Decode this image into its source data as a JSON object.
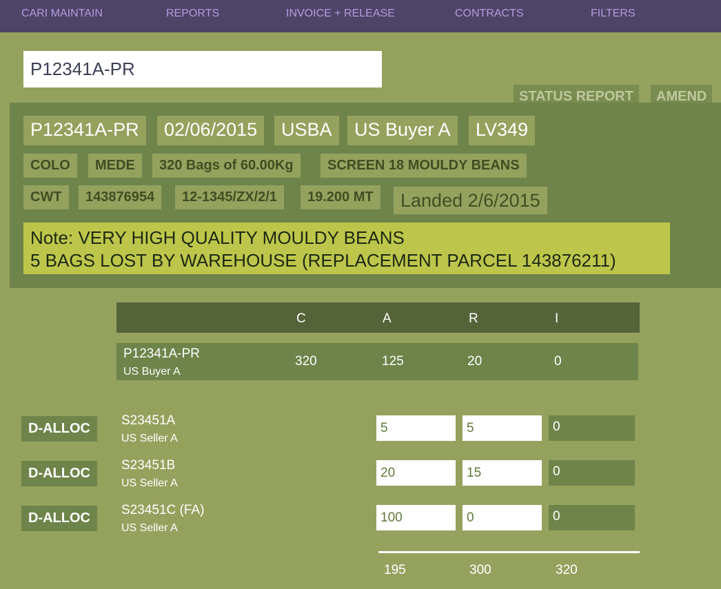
{
  "nav": {
    "items": [
      "CARI MAINTAIN",
      "REPORTS",
      "INVOICE + RELEASE",
      "CONTRACTS",
      "FILTERS"
    ]
  },
  "search": {
    "value": "P12341A-PR"
  },
  "actions": {
    "status_report": "STATUS REPORT",
    "amend": "AMEND"
  },
  "parcel": {
    "row1": [
      "P12341A-PR",
      "02/06/2015",
      "USBA",
      "US Buyer A",
      "LV349"
    ],
    "row2": [
      "COLO",
      "MEDE",
      "320 Bags of 60.00Kg",
      "SCREEN 18 MOULDY BEANS"
    ],
    "row3": [
      "CWT",
      "143876954",
      "12-1345/ZX/2/1",
      "19.200 MT"
    ],
    "landed": "Landed 2/6/2015",
    "note_line1": "Note: VERY HIGH QUALITY MOULDY BEANS",
    "note_line2": "5 BAGS LOST BY WAREHOUSE (REPLACEMENT PARCEL 143876211)"
  },
  "table": {
    "headers": [
      "C",
      "A",
      "R",
      "I"
    ],
    "summary": {
      "id": "P12341A-PR",
      "party": "US Buyer A",
      "values": [
        "320",
        "125",
        "20",
        "0"
      ]
    },
    "allocations": [
      {
        "button": "D-ALLOC",
        "id": "S23451A",
        "party": "US Seller A",
        "a": "5",
        "r": "5",
        "i": "0"
      },
      {
        "button": "D-ALLOC",
        "id": "S23451B",
        "party": "US Seller A",
        "a": "20",
        "r": "15",
        "i": "0"
      },
      {
        "button": "D-ALLOC",
        "id": "S23451C (FA)",
        "party": "US Seller A",
        "a": "100",
        "r": "0",
        "i": "0"
      }
    ],
    "totals": [
      "195",
      "300",
      "320"
    ]
  }
}
